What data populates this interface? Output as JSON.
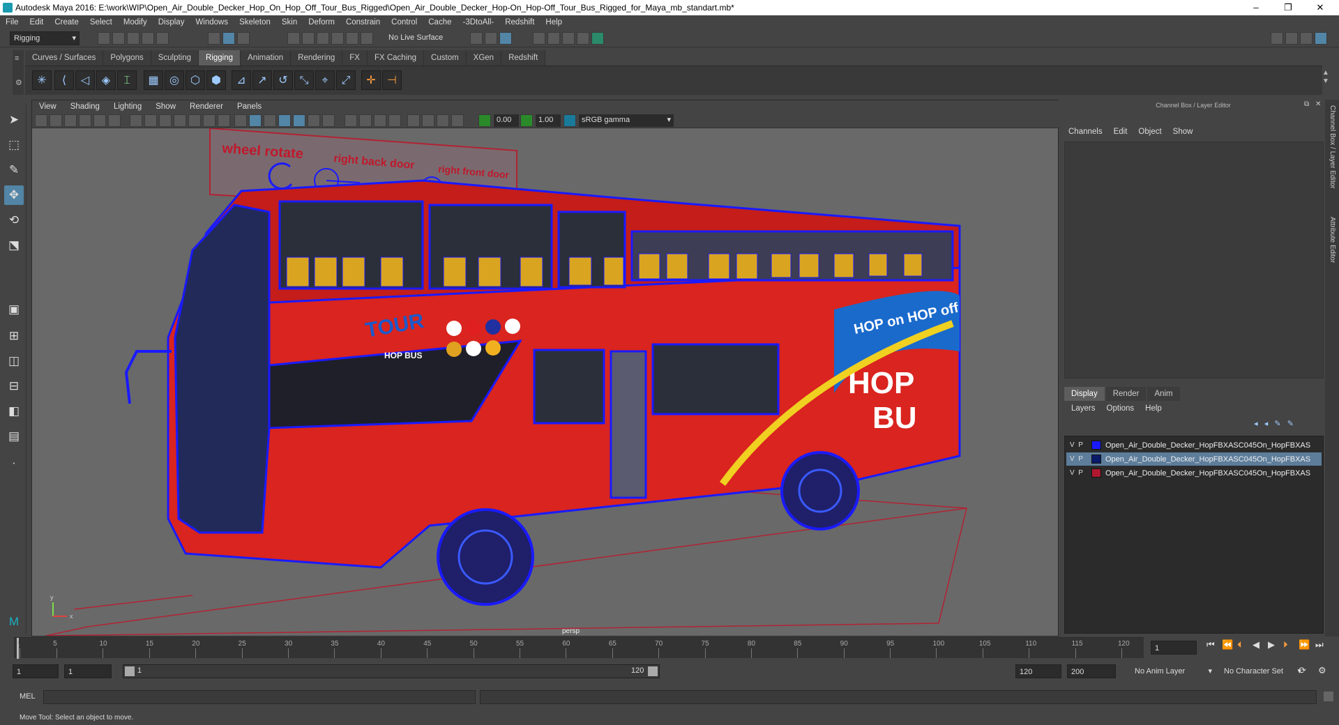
{
  "window": {
    "title": "Autodesk Maya 2016: E:\\work\\WIP\\Open_Air_Double_Decker_Hop_On_Hop_Off_Tour_Bus_Rigged\\Open_Air_Double_Decker_Hop-On_Hop-Off_Tour_Bus_Rigged_for_Maya_mb_standart.mb*",
    "controls": {
      "minimize": "–",
      "restore": "❐",
      "close": "✕"
    }
  },
  "menubar": [
    "File",
    "Edit",
    "Create",
    "Select",
    "Modify",
    "Display",
    "Windows",
    "Skeleton",
    "Skin",
    "Deform",
    "Constrain",
    "Control",
    "Cache",
    "-3DtoAll-",
    "Redshift",
    "Help"
  ],
  "status_line": {
    "menu_set": "Rigging",
    "live_surface": "No Live Surface"
  },
  "shelf": {
    "tabs": [
      "Curves / Surfaces",
      "Polygons",
      "Sculpting",
      "Rigging",
      "Animation",
      "Rendering",
      "FX",
      "FX Caching",
      "Custom",
      "XGen",
      "Redshift"
    ],
    "active_tab": "Rigging"
  },
  "viewport": {
    "menu": [
      "View",
      "Shading",
      "Lighting",
      "Show",
      "Renderer",
      "Panels"
    ],
    "exposure": "0.00",
    "gamma": "1.00",
    "color_space": "sRGB gamma",
    "camera_label": "persp",
    "scene_labels": {
      "wheel_rotate": "wheel rotate",
      "right_back_door": "right back door",
      "right_front_door": "right front door"
    },
    "decal_texts": {
      "tour": "TOUR",
      "hop_bus_small": "HOP BUS",
      "hop_on_hop_off": "HOP on HOP off",
      "hop": "HOP",
      "bus": "BU"
    },
    "axis": {
      "y": "y",
      "x": "x"
    }
  },
  "channel_box": {
    "header": "Channel Box / Layer Editor",
    "menu": [
      "Channels",
      "Edit",
      "Object",
      "Show"
    ]
  },
  "layer_editor": {
    "tabs": [
      "Display",
      "Render",
      "Anim"
    ],
    "active_tab": "Display",
    "menu": [
      "Layers",
      "Options",
      "Help"
    ],
    "layers": [
      {
        "v": "V",
        "p": "P",
        "name": "Open_Air_Double_Decker_HopFBXASC045On_HopFBXAS",
        "color": "#1a1aff",
        "selected": false
      },
      {
        "v": "V",
        "p": "P",
        "name": "Open_Air_Double_Decker_HopFBXASC045On_HopFBXAS",
        "color": "#0a1a6a",
        "selected": true
      },
      {
        "v": "V",
        "p": "P",
        "name": "Open_Air_Double_Decker_HopFBXASC045On_HopFBXAS",
        "color": "#b01830",
        "selected": false
      }
    ]
  },
  "side_tabs": [
    "Channel Box / Layer Editor",
    "Attribute Editor"
  ],
  "timeline": {
    "ticks": [
      "1",
      "5",
      "10",
      "15",
      "20",
      "25",
      "30",
      "35",
      "40",
      "45",
      "50",
      "55",
      "60",
      "65",
      "70",
      "75",
      "80",
      "85",
      "90",
      "95",
      "100",
      "105",
      "110",
      "115",
      "120"
    ],
    "current_frame": "1"
  },
  "range": {
    "start": "1",
    "playback_start": "1",
    "slider_start": "1",
    "slider_end": "120",
    "playback_end": "120",
    "end": "200",
    "anim_layer": "No Anim Layer",
    "character_set": "No Character Set"
  },
  "command_line": {
    "label": "MEL"
  },
  "help_line": "Move Tool: Select an object to move."
}
